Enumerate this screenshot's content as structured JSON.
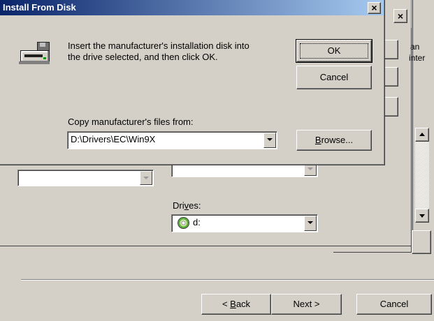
{
  "dialog": {
    "title": "Install From Disk",
    "message_line1": "Insert the manufacturer's installation disk into",
    "message_line2": "the drive selected, and then click OK.",
    "ok_label": "OK",
    "cancel_label": "Cancel",
    "copy_label": "Copy manufacturer's files from:",
    "path_value": "D:\\Drivers\\EC\\Win9X",
    "browse_label_underlined": "B",
    "browse_label_rest": "rowse...",
    "close_glyph": "×"
  },
  "background_window": {
    "close_glyph": "×",
    "side_text1": "an",
    "side_text2": "inter",
    "drives_label_a": "Dri",
    "drives_label_u": "v",
    "drives_label_b": "es:",
    "drive_value": "d:"
  },
  "wizard": {
    "back_label_prefix": "< ",
    "back_label_underlined": "B",
    "back_label_rest": "ack",
    "next_label": "Next >",
    "cancel_label": "Cancel"
  }
}
